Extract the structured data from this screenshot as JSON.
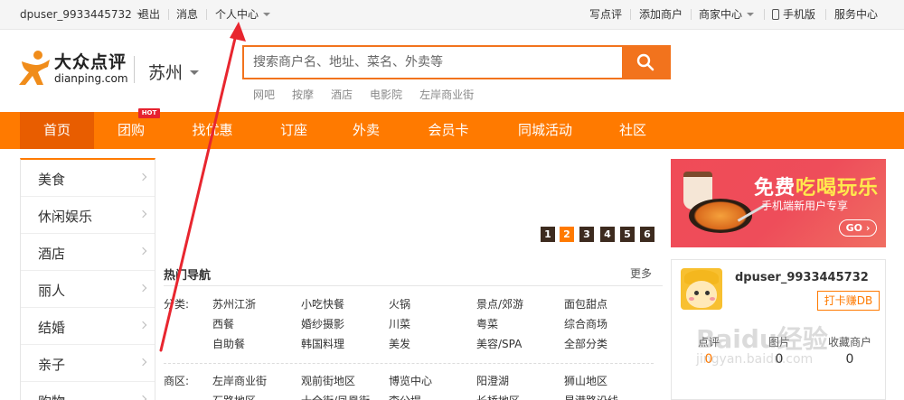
{
  "topbar": {
    "username": "dpuser_9933445732",
    "logout": "退出",
    "messages": "消息",
    "user_center": "个人中心",
    "write_review": "写点评",
    "add_merchant": "添加商户",
    "merchant_center": "商家中心",
    "mobile": "手机版",
    "service_center": "服务中心"
  },
  "header": {
    "logo_cn": "大众点评",
    "logo_en": "dianping.com",
    "city": "苏州",
    "search_placeholder": "搜索商户名、地址、菜名、外卖等",
    "hot_words": [
      "网吧",
      "按摩",
      "酒店",
      "电影院",
      "左岸商业街"
    ]
  },
  "nav": {
    "items": [
      "首页",
      "团购",
      "找优惠",
      "订座",
      "外卖",
      "会员卡",
      "同城活动",
      "社区"
    ],
    "active": "首页",
    "hot_badge": "HOT"
  },
  "categories": [
    "美食",
    "休闲娱乐",
    "酒店",
    "丽人",
    "结婚",
    "亲子",
    "购物"
  ],
  "pagination": {
    "pages": [
      "1",
      "2",
      "3",
      "4",
      "5",
      "6"
    ],
    "active": "2"
  },
  "hot_nav": {
    "title": "热门导航",
    "more": "更多",
    "category_label": "分类:",
    "category_links": [
      [
        "苏州江浙",
        "小吃快餐",
        "火锅",
        "景点/郊游",
        "面包甜点"
      ],
      [
        "西餐",
        "婚纱摄影",
        "川菜",
        "粤菜",
        "综合商场"
      ],
      [
        "自助餐",
        "韩国料理",
        "美发",
        "美容/SPA",
        "全部分类"
      ]
    ],
    "district_label": "商区:",
    "district_links": [
      [
        "左岸商业街",
        "观前街地区",
        "博览中心",
        "阳澄湖",
        "狮山地区"
      ],
      [
        "石路地区",
        "十全街/凤凰街",
        "李公堤",
        "长桥地区",
        "星港路沿线"
      ]
    ]
  },
  "ad": {
    "headline_prefix": "免费",
    "headline_highlight": "吃喝玩乐",
    "subline": "手机端新用户专享",
    "go": "GO"
  },
  "user_card": {
    "username": "dpuser_9933445732",
    "checkin": "打卡赚DB",
    "stats": [
      {
        "label": "点评",
        "value": "0"
      },
      {
        "label": "图片",
        "value": "0"
      },
      {
        "label": "收藏商户",
        "value": "0"
      }
    ]
  },
  "watermark": {
    "brand": "Baidu经验",
    "url": "jingyan.baidu.com"
  },
  "colors": {
    "accent": "#ff7a00",
    "nav_active": "#e85d00",
    "search_border": "#f2731d",
    "hot_badge": "#e6222f",
    "arrow": "#e8262f"
  }
}
